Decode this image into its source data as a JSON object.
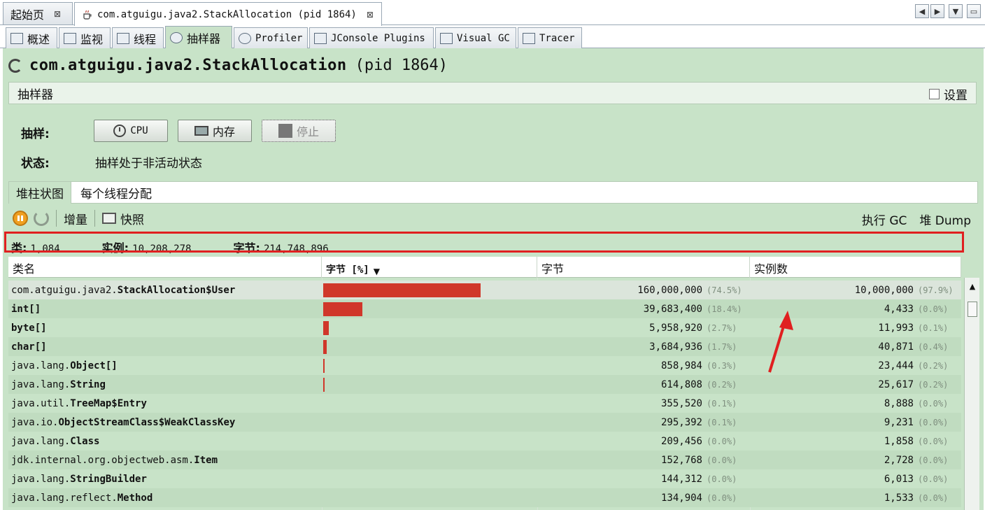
{
  "doc_tabs": [
    {
      "label": "起始页",
      "close": "⊠"
    },
    {
      "label": "com.atguigu.java2.StackAllocation (pid 1864)",
      "close": "⊠"
    }
  ],
  "view_tabs": [
    "概述",
    "监视",
    "线程",
    "抽样器",
    "Profiler",
    "JConsole Plugins",
    "Visual GC",
    "Tracer"
  ],
  "process": {
    "name": "com.atguigu.java2.StackAllocation",
    "pid": "(pid 1864)"
  },
  "sampler": {
    "title": "抽样器",
    "settings_label": "设置",
    "sample_label": "抽样:",
    "cpu_button": "CPU",
    "memory_button": "内存",
    "stop_button": "停止",
    "status_label": "状态:",
    "status_text": "抽样处于非活动状态"
  },
  "subtabs": [
    "堆柱状图",
    "每个线程分配"
  ],
  "toolbar": {
    "delta": "增量",
    "snapshot": "快照",
    "gc": "执行 GC",
    "heap_dump": "堆 Dump"
  },
  "summary": {
    "classes_label": "类:",
    "classes": "1,084",
    "instances_label": "实例:",
    "instances": "10,208,278",
    "bytes_label": "字节:",
    "bytes": "214,748,896"
  },
  "table": {
    "headers": [
      "类名",
      "字节 [%]",
      "字节",
      "实例数"
    ],
    "sort_indicator": "▼",
    "rows": [
      {
        "pkg": "com.atguigu.java2.",
        "name": "StackAllocation$User",
        "bytes": "160,000,000",
        "bytes_pct": "(74.5%)",
        "instances": "10,000,000",
        "inst_pct": "(97.9%)",
        "bar": 0.745
      },
      {
        "pkg": "",
        "name": "int[]",
        "bytes": "39,683,400",
        "bytes_pct": "(18.4%)",
        "instances": "4,433",
        "inst_pct": "(0.0%)",
        "bar": 0.184
      },
      {
        "pkg": "",
        "name": "byte[]",
        "bytes": "5,958,920",
        "bytes_pct": "(2.7%)",
        "instances": "11,993",
        "inst_pct": "(0.1%)",
        "bar": 0.027
      },
      {
        "pkg": "",
        "name": "char[]",
        "bytes": "3,684,936",
        "bytes_pct": "(1.7%)",
        "instances": "40,871",
        "inst_pct": "(0.4%)",
        "bar": 0.017
      },
      {
        "pkg": "java.lang.",
        "name": "Object[]",
        "bytes": "858,984",
        "bytes_pct": "(0.3%)",
        "instances": "23,444",
        "inst_pct": "(0.2%)",
        "bar": 0.003
      },
      {
        "pkg": "java.lang.",
        "name": "String",
        "bytes": "614,808",
        "bytes_pct": "(0.2%)",
        "instances": "25,617",
        "inst_pct": "(0.2%)",
        "bar": 0.002
      },
      {
        "pkg": "java.util.",
        "name": "TreeMap$Entry",
        "bytes": "355,520",
        "bytes_pct": "(0.1%)",
        "instances": "8,888",
        "inst_pct": "(0.0%)",
        "bar": 0.0
      },
      {
        "pkg": "java.io.",
        "name": "ObjectStreamClass$WeakClassKey",
        "bytes": "295,392",
        "bytes_pct": "(0.1%)",
        "instances": "9,231",
        "inst_pct": "(0.0%)",
        "bar": 0.0
      },
      {
        "pkg": "java.lang.",
        "name": "Class",
        "bytes": "209,456",
        "bytes_pct": "(0.0%)",
        "instances": "1,858",
        "inst_pct": "(0.0%)",
        "bar": 0.0
      },
      {
        "pkg": "jdk.internal.org.objectweb.asm.",
        "name": "Item",
        "bytes": "152,768",
        "bytes_pct": "(0.0%)",
        "instances": "2,728",
        "inst_pct": "(0.0%)",
        "bar": 0.0
      },
      {
        "pkg": "java.lang.",
        "name": "StringBuilder",
        "bytes": "144,312",
        "bytes_pct": "(0.0%)",
        "instances": "6,013",
        "inst_pct": "(0.0%)",
        "bar": 0.0
      },
      {
        "pkg": "java.lang.reflect.",
        "name": "Method",
        "bytes": "134,904",
        "bytes_pct": "(0.0%)",
        "instances": "1,533",
        "inst_pct": "(0.0%)",
        "bar": 0.0
      }
    ]
  },
  "colors": {
    "panel_bg": "#c8e3c8",
    "bar": "#d0372a",
    "highlight": "#e02020"
  }
}
